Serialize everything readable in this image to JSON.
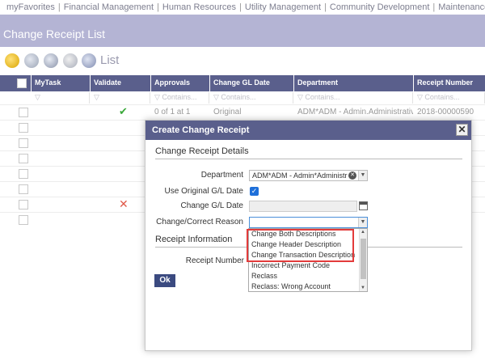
{
  "topnav": {
    "items": [
      "myFavorites",
      "Financial Management",
      "Human Resources",
      "Utility Management",
      "Community Development",
      "Maintenance"
    ]
  },
  "page": {
    "title": "Change Receipt List"
  },
  "toolbar": {
    "list_label": "List"
  },
  "grid": {
    "columns": [
      "MyTask",
      "Validate",
      "Approvals",
      "Change GL Date",
      "Department",
      "Receipt Number"
    ],
    "filter_placeholder": "Contains...",
    "row": {
      "approvals": "0 of 1 at 1",
      "change_gl_date": "Original",
      "department": "ADM*ADM - Admin.Administrativ...",
      "receipt_number": "2018-00000590"
    }
  },
  "dialog": {
    "title": "Create Change Receipt",
    "close_label": "✕",
    "details_section": "Change Receipt Details",
    "department_label": "Department",
    "department_value": "ADM*ADM - Admin*Administr",
    "use_original_label": "Use Original G/L Date",
    "change_gl_label": "Change G/L Date",
    "reason_label": "Change/Correct Reason",
    "reason_value": "",
    "receipt_section": "Receipt Information",
    "receipt_number_label": "Receipt Number",
    "ok_label": "Ok",
    "reason_options": [
      "Change Both Descriptions",
      "Change Header Description",
      "Change Transaction Description",
      "Incorrect Payment Code",
      "Reclass",
      "Reclass: Wrong Account"
    ]
  },
  "colors": {
    "header_bar": "#b4b4d4",
    "grid_header": "#5a5f8c",
    "dialog_header": "#5a5f8c",
    "highlight": "#e33b3b",
    "ok_button": "#3b4a80"
  }
}
